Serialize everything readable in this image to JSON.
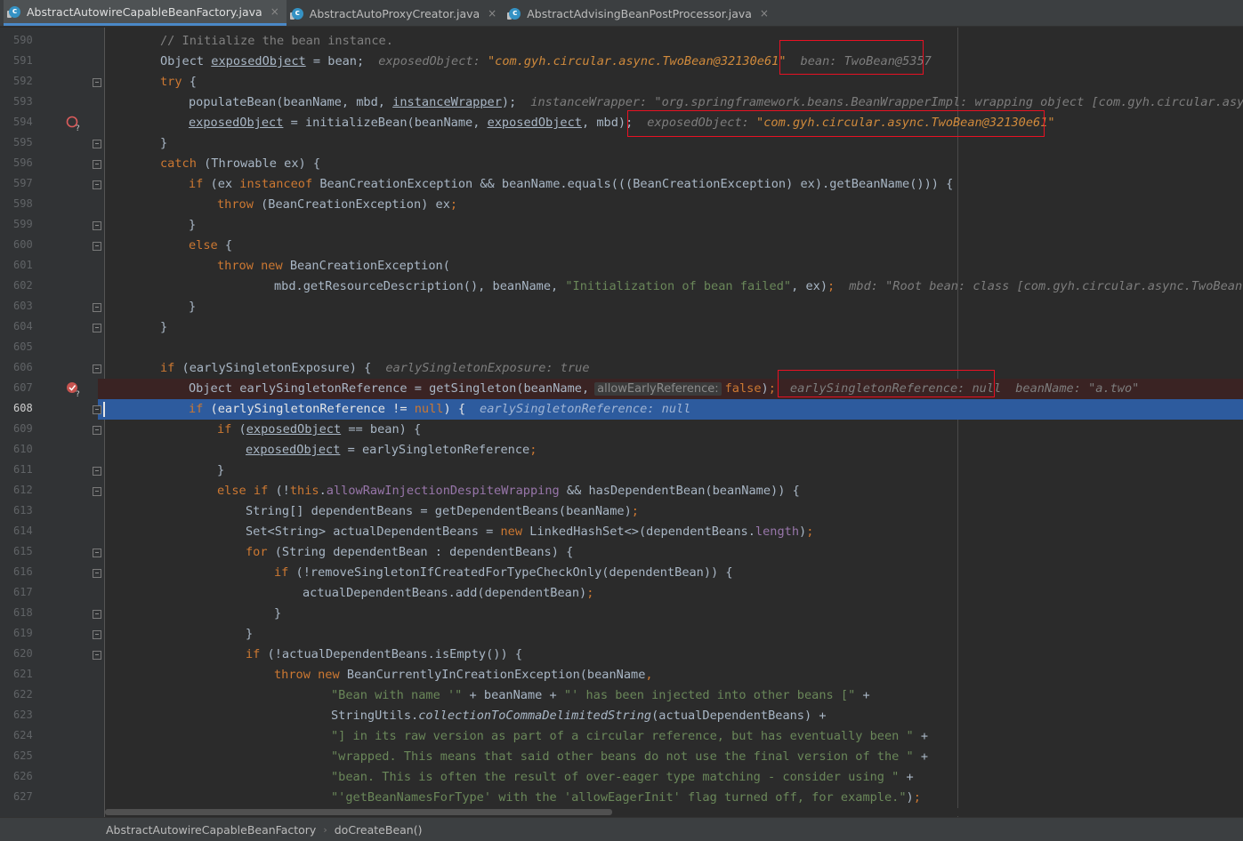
{
  "tabs": [
    {
      "label": "AbstractAutowireCapableBeanFactory.java",
      "active": true
    },
    {
      "label": "AbstractAutoProxyCreator.java",
      "active": false
    },
    {
      "label": "AbstractAdvisingBeanPostProcessor.java",
      "active": false
    }
  ],
  "breadcrumb": {
    "class_name": "AbstractAutowireCapableBeanFactory",
    "method_name": "doCreateBean()"
  },
  "gutter": {
    "line_numbers": [
      "590",
      "591",
      "592",
      "593",
      "594",
      "595",
      "596",
      "597",
      "598",
      "599",
      "600",
      "601",
      "602",
      "603",
      "604",
      "605",
      "606",
      "607",
      "608",
      "609",
      "610",
      "611",
      "612",
      "613",
      "614",
      "615",
      "616",
      "617",
      "618",
      "619",
      "620",
      "621",
      "622",
      "623",
      "624",
      "625",
      "626",
      "627"
    ],
    "breakpoint_lines": [
      "594",
      "607"
    ],
    "current_line": "608"
  },
  "hints": {
    "l591_var": "exposedObject:",
    "l591_val": "\"com.gyh.circular.async.TwoBean@32130e61\"",
    "l591_bean": "bean: TwoBean@5357",
    "l593": "instanceWrapper: \"org.springframework.beans.BeanWrapperImpl: wrapping object [com.gyh.circular.async.",
    "l594_var": "exposedObject:",
    "l594_val": "\"com.gyh.circular.async.TwoBean@32130e61\"",
    "l602": "mbd: \"Root bean: class [com.gyh.circular.async.TwoBean];",
    "l606": "earlySingletonExposure: true",
    "l607_param": "allowEarlyReference:",
    "l607_ref": "earlySingletonReference: null",
    "l607_name": "beanName: \"a.two\"",
    "l608": "earlySingletonReference: null"
  }
}
